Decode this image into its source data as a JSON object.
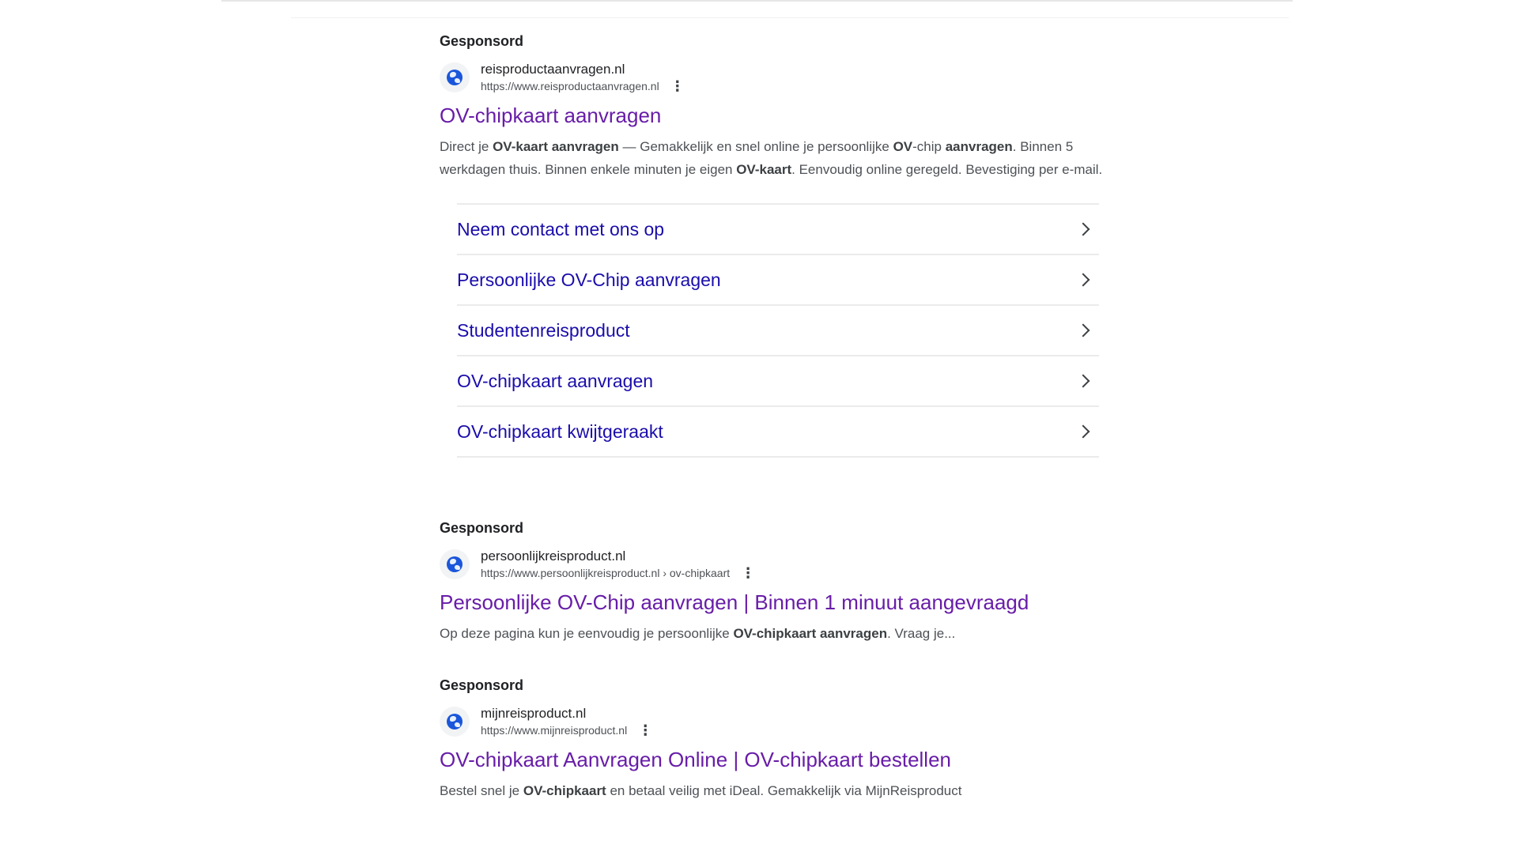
{
  "ads": [
    {
      "sponsored_label": "Gesponsord",
      "site_name": "reisproductaanvragen.nl",
      "site_url": "https://www.reisproductaanvragen.nl",
      "menu_icon": "more-vertical-icon",
      "title": "OV-chipkaart aanvragen",
      "description_parts": [
        {
          "text": "Direct je ",
          "bold": false
        },
        {
          "text": "OV-kaart aanvragen",
          "bold": true
        },
        {
          "text": " — Gemakkelijk en snel online je persoonlijke ",
          "bold": false
        },
        {
          "text": "OV",
          "bold": true
        },
        {
          "text": "-chip ",
          "bold": false
        },
        {
          "text": "aanvragen",
          "bold": true
        },
        {
          "text": ". Binnen 5 werkdagen thuis. Binnen enkele minuten je eigen ",
          "bold": false
        },
        {
          "text": "OV-kaart",
          "bold": true
        },
        {
          "text": ". Eenvoudig online geregeld. Bevestiging per e-mail.",
          "bold": false
        }
      ],
      "sitelinks": [
        "Neem contact met ons op",
        "Persoonlijke OV-Chip aanvragen",
        "Studentenreisproduct",
        "OV-chipkaart aanvragen",
        "OV-chipkaart kwijtgeraakt"
      ]
    },
    {
      "sponsored_label": "Gesponsord",
      "site_name": "persoonlijkreisproduct.nl",
      "site_url": "https://www.persoonlijkreisproduct.nl › ov-chipkaart",
      "menu_icon": "more-vertical-icon",
      "title": "Persoonlijke OV-Chip aanvragen | Binnen 1 minuut aangevraagd",
      "description_parts": [
        {
          "text": "Op deze pagina kun je eenvoudig je persoonlijke ",
          "bold": false
        },
        {
          "text": "OV-chipkaart aanvragen",
          "bold": true
        },
        {
          "text": ". Vraag je...",
          "bold": false
        }
      ],
      "sitelinks": []
    },
    {
      "sponsored_label": "Gesponsord",
      "site_name": "mijnreisproduct.nl",
      "site_url": "https://www.mijnreisproduct.nl",
      "menu_icon": "more-vertical-icon",
      "title": "OV-chipkaart Aanvragen Online | OV-chipkaart bestellen",
      "description_parts": [
        {
          "text": "Bestel snel je ",
          "bold": false
        },
        {
          "text": "OV-chipkaart",
          "bold": true
        },
        {
          "text": " en betaal veilig met iDeal. Gemakkelijk via MijnReisproduct",
          "bold": false
        }
      ],
      "sitelinks": []
    }
  ],
  "colors": {
    "visited_title": "#681da8",
    "sitelink": "#1a0dab",
    "body_text": "#4d5156"
  }
}
